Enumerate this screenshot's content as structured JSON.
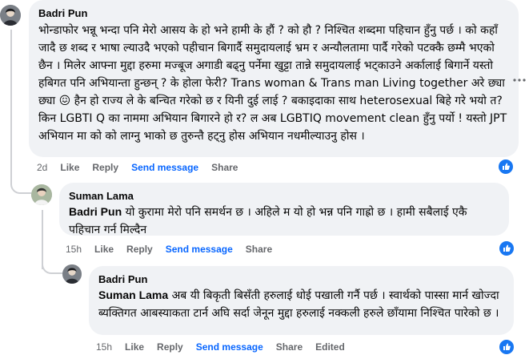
{
  "comments": [
    {
      "author": "Badri Pun",
      "mention": "",
      "text": "भोन्डाफोर भन्नू भन्दा पनि मेरो आसय के हो भने हामी के हौं ? को हौ ? निश्चित शब्दमा पहिचान हुँनु पर्छ । को कहाँ जादै छ शब्द र भाषा ल्याउदै भएको पहीचान बिगार्दै समुदायलाई भ्रम र अन्यौलतामा पार्दै गरेको पटक्कै छम्मै भएको छैन । मिलेर आफ्ना मुद्दा हरुमा मज्बूज अगाडी बढ्नु पर्नेमा खुट्टा तान्ने समुदायलाई भट्काउने अर्कालाई बिगार्ने यस्तो हबिगत पनि अभियान्ता हुन्छन् ? के होला फेरी? Trans woman & Trans man Living together अरे छ्या छ्या 😖 हैन हो राज्य ले के बन्चित गरेको छ र यिनी दुई लाई ? बकाइदाका साथ heterosexual बिहे गरे भयो त? किन LGBTI Q का नाममा अभियान बिगारने हो र? ल अब LGBTIQ movement clean हुँनु पर्यो ! यस्तो JPT अभियान मा को को लाग्नु भाको छ तुरुन्तै हट्नु होस अभियान नधमील्याउनु होस ।",
      "time": "2d",
      "like": "Like",
      "reply": "Reply",
      "send": "Send message",
      "share": "Share",
      "edited": ""
    },
    {
      "author": "Suman Lama",
      "mention": "Badri Pun",
      "text": " यो कुरामा मेरो पनि समर्थन छ । अहिले म यो हो भन्न पनि गाह्रो छ । हामी सबैलाई एकै पहिचान गर्न मिल्दैन",
      "time": "15h",
      "like": "Like",
      "reply": "Reply",
      "send": "Send message",
      "share": "Share",
      "edited": ""
    },
    {
      "author": "Badri Pun",
      "mention": "Suman Lama",
      "text": " अब यी बिकृती बिसँती हरुलाई धोई पखाली गर्नै पर्छ । स्वार्थको पास्सा मार्न खोज्दा ब्यक्तिगत आबस्याकता टार्न अघि सर्दा जेनून मुद्दा हरुलाई नक्कली हरुले छाँयामा निश्चित पारेको छ ।",
      "time": "15h",
      "like": "Like",
      "reply": "Reply",
      "send": "Send message",
      "share": "Share",
      "edited": "Edited"
    }
  ],
  "icons": {
    "like_badge": "thumbs-up-icon",
    "more": "more-options-icon"
  },
  "colors": {
    "bubble_bg": "#f0f2f5",
    "link_blue": "#0866ff",
    "like_blue": "#1877f2",
    "meta_gray": "#65676b"
  }
}
